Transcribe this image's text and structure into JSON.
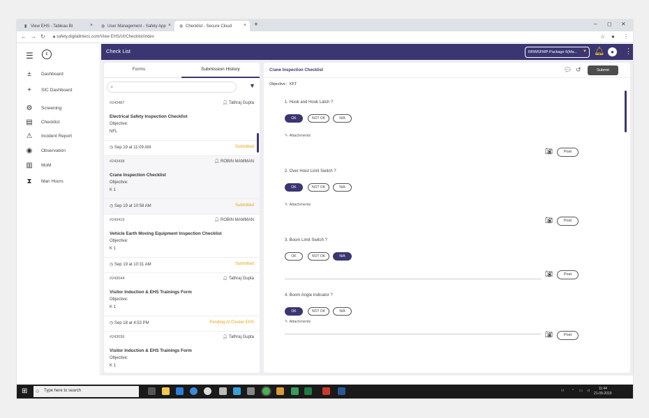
{
  "browser": {
    "tabs": [
      {
        "label": "View EHS - Tableau BI",
        "icon": "chart-icon"
      },
      {
        "label": "User Management - Safety App",
        "icon": "globe-icon"
      },
      {
        "label": "Checklist - Secure Cloud",
        "icon": "globe-icon"
      }
    ],
    "url": "safety.digitallntecc.com/View EHS/UI/Checklist/index"
  },
  "sidebar": {
    "items": [
      {
        "label": "Dashboard",
        "icon": "plus-cross-icon"
      },
      {
        "label": "SIC Dashboard",
        "icon": "plus-icon"
      },
      {
        "label": "Screening",
        "icon": "gear-icon"
      },
      {
        "label": "Checklist",
        "icon": "list-icon"
      },
      {
        "label": "Incident Report",
        "icon": "warning-icon"
      },
      {
        "label": "Observation",
        "icon": "eye-icon"
      },
      {
        "label": "MoM",
        "icon": "document-icon"
      },
      {
        "label": "Man Hours",
        "icon": "hourglass-icon"
      }
    ]
  },
  "topbar": {
    "title": "Check List",
    "project": "RRWSFMP-Package 6(Ma..."
  },
  "leftpanel": {
    "tabs": [
      "Forms",
      "Submission History"
    ],
    "search_placeholder": "",
    "cards": [
      {
        "id": "#243487",
        "by": "Tathraj Gupta",
        "name": "Electrical Safety Inspection Checklist",
        "objective_label": "Objective:",
        "objective": "NFL",
        "date": "Sep 19 at 11:09 AM",
        "status": "Submitted"
      },
      {
        "id": "#243438",
        "by": "ROBIN MAMMAN",
        "name": "Crane Inspection Checklist",
        "objective_label": "Objective:",
        "objective": "K 1",
        "date": "Sep 19 at 10:58 AM",
        "status": "Submitted"
      },
      {
        "id": "#243419",
        "by": "ROBIN MAMMAN",
        "name": "Vehicle Earth Moving Equipment Inspection Checklist",
        "objective_label": "Objective:",
        "objective": "K 1",
        "date": "Sep 19 at 10:31 AM",
        "status": "Submitted"
      },
      {
        "id": "#243044",
        "by": "Tathraj Gupta",
        "name": "Visitor Induction & EHS Trainings Form",
        "objective_label": "Objective:",
        "objective": "K 1",
        "date": "Sep 18 at 4:53 PM",
        "status": "Pending At Cluster EHS"
      },
      {
        "id": "#243036",
        "by": "Tathraj Gupta",
        "name": "Visitor Induction & EHS Trainings Form",
        "objective_label": "Objective:",
        "objective": "K 1",
        "date": "",
        "status": ""
      }
    ]
  },
  "rightpanel": {
    "title": "Crane Inspection Checklist",
    "submit_label": "Submit",
    "sub_tabs": [
      "Objective",
      "KFT"
    ],
    "questions": [
      {
        "text": "1. Hook and Hook Latch ?",
        "options": [
          "OK",
          "NOT OK",
          "N/A"
        ],
        "selected": 0,
        "attachment": "Attachments",
        "post": "Post"
      },
      {
        "text": "2. Over Hoist Limit Switch ?",
        "options": [
          "OK",
          "NOT OK",
          "N/A"
        ],
        "selected": 0,
        "attachment": "Attachments",
        "post": "Post"
      },
      {
        "text": "3. Boom Limit Switch ?",
        "options": [
          "OK",
          "NOT OK",
          "N/A"
        ],
        "selected": 2,
        "attachment": "",
        "post": "Post"
      },
      {
        "text": "4. Boom Angle Indicator ?",
        "options": [
          "OK",
          "NOT OK",
          "N/A"
        ],
        "selected": 0,
        "attachment": "Attachments",
        "post": "Post"
      }
    ]
  },
  "taskbar": {
    "search_placeholder": "Type here to search",
    "time": "11:44",
    "date": "21-09-2019"
  },
  "colors": {
    "accent": "#3b3671",
    "status_submitted": "#e8a317",
    "bell": "#f5c518"
  }
}
